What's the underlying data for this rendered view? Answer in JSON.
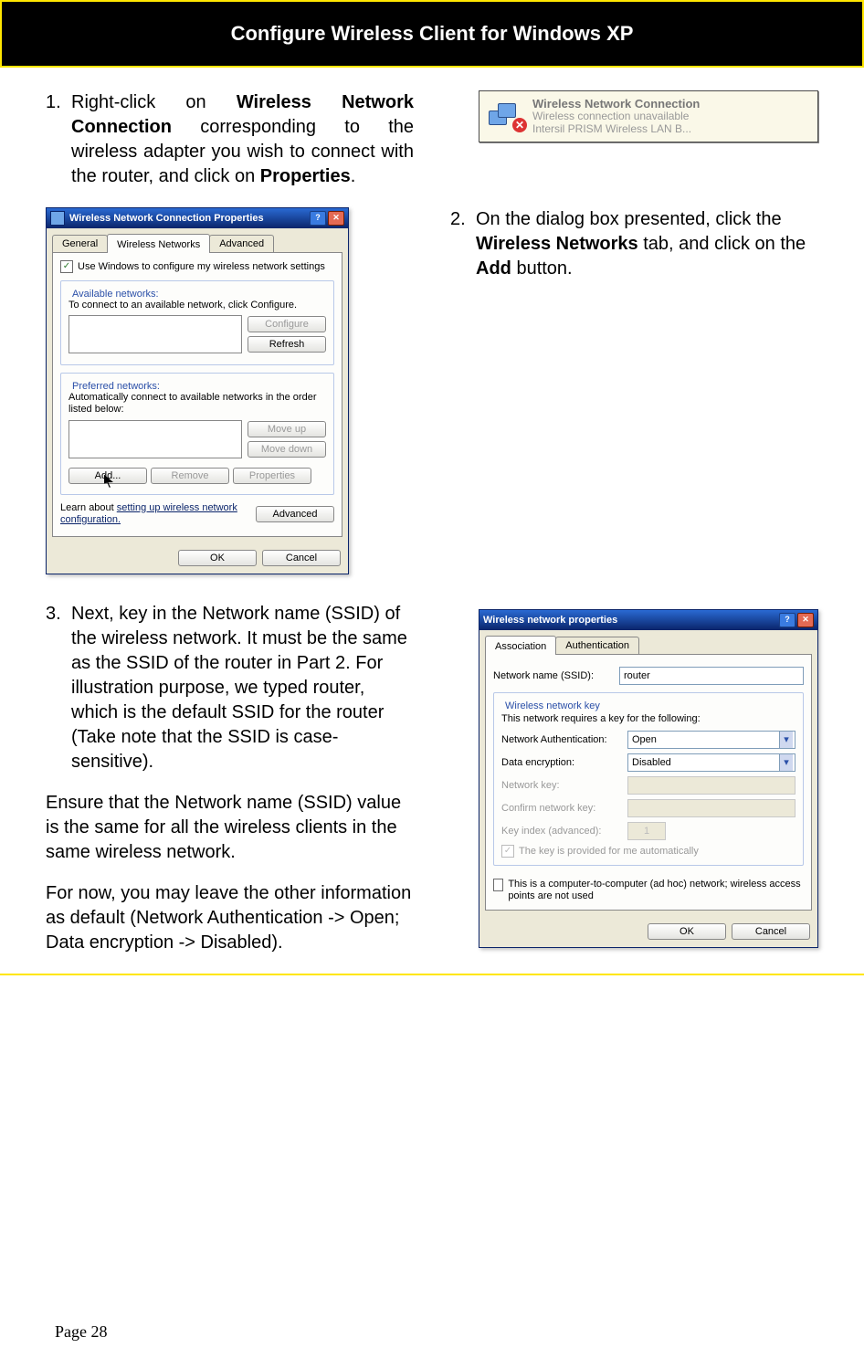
{
  "header": {
    "title": "Configure Wireless Client for Windows XP"
  },
  "notif": {
    "title": "Wireless Network Connection",
    "line1": "Wireless connection unavailable",
    "line2": "Intersil PRISM Wireless LAN B..."
  },
  "step1": {
    "num": "1.",
    "t1": "Right-click on ",
    "b1": "Wireless Network Connection",
    "t2": " corresponding to the wireless adapter you wish to connect with the router, and click on ",
    "b2": "Properties",
    "t3": "."
  },
  "step2": {
    "num": "2.",
    "t1": "On the dialog box presented, click the ",
    "b1": "Wireless Networks",
    "t2": " tab, and click on the ",
    "b2": "Add",
    "t3": " button."
  },
  "step3": {
    "num": "3.",
    "text": "Next, key in the Network name (SSID) of the wireless network. It must be the same as the SSID of the router in Part 2. For illustration purpose, we typed router, which is the default SSID for the router (Take note that the SSID is case-sensitive)."
  },
  "para1": "Ensure that the Network name (SSID) value is the same for all the wireless clients in the same wireless network.",
  "para2": "For now, you may leave the other information as default (Network Authentication -> Open; Data encryption -> Disabled).",
  "dlg1": {
    "title": "Wireless Network Connection Properties",
    "tabs": {
      "general": "General",
      "wireless": "Wireless Networks",
      "advanced": "Advanced"
    },
    "chk": "Use Windows to configure my wireless network settings",
    "avail_legend": "Available networks:",
    "avail_hint": "To connect to an available network, click Configure.",
    "btn_configure": "Configure",
    "btn_refresh": "Refresh",
    "pref_legend": "Preferred networks:",
    "pref_hint": "Automatically connect to available networks in the order listed below:",
    "btn_moveup": "Move up",
    "btn_movedown": "Move down",
    "btn_add": "Add...",
    "btn_remove": "Remove",
    "btn_props": "Properties",
    "learn1": "Learn about ",
    "learn_link": "setting up wireless network configuration.",
    "btn_advanced": "Advanced",
    "ok": "OK",
    "cancel": "Cancel"
  },
  "dlg2": {
    "title": "Wireless network properties",
    "tab_assoc": "Association",
    "tab_auth": "Authentication",
    "lbl_ssid": "Network name (SSID):",
    "val_ssid": "router",
    "key_legend": "Wireless network key",
    "key_hint": "This network requires a key for the following:",
    "lbl_auth": "Network Authentication:",
    "val_auth": "Open",
    "lbl_enc": "Data encryption:",
    "val_enc": "Disabled",
    "lbl_key": "Network key:",
    "lbl_ckey": "Confirm network key:",
    "lbl_idx": "Key index (advanced):",
    "val_idx": "1",
    "chk_auto": "The key is provided for me automatically",
    "chk_adhoc": "This is a computer-to-computer (ad hoc) network; wireless access points are not used",
    "ok": "OK",
    "cancel": "Cancel"
  },
  "footer": {
    "page": "Page 28"
  }
}
